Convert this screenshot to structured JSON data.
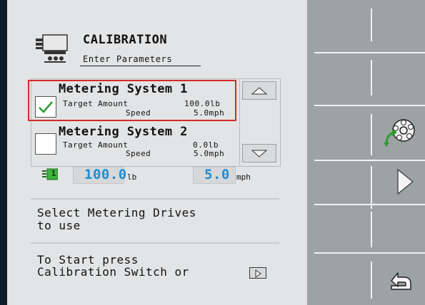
{
  "header": {
    "title": "CALIBRATION",
    "subtitle": "Enter Parameters",
    "icon": "metering-unit-icon"
  },
  "metering_list": {
    "items": [
      {
        "title": "Metering System 1",
        "checked": true,
        "target_label": "Target Amount",
        "target_value": "100.0lb",
        "speed_label": "Speed",
        "speed_value": "5.0mph"
      },
      {
        "title": "Metering System 2",
        "checked": false,
        "target_label": "Target Amount",
        "target_value": "0.0lb",
        "speed_label": "Speed",
        "speed_value": "5.0mph"
      }
    ],
    "scroll_up_icon": "triangle-up-icon",
    "scroll_down_icon": "triangle-down-icon"
  },
  "summary": {
    "meter_badge": "1",
    "amount": "100.0",
    "amount_unit": "lb",
    "speed": "5.0",
    "speed_unit": "mph"
  },
  "messages": {
    "select_line1": "Select Metering Drives",
    "select_line2": "to use",
    "start_line1": "To Start press",
    "start_line2": "Calibration Switch or"
  },
  "softkeys": [
    {
      "name": "softkey-1",
      "icon": ""
    },
    {
      "name": "softkey-2",
      "icon": ""
    },
    {
      "name": "softkey-3",
      "icon": "calibrate-meter-icon"
    },
    {
      "name": "softkey-4",
      "icon": "play-icon"
    },
    {
      "name": "softkey-5",
      "icon": ""
    },
    {
      "name": "softkey-6",
      "icon": "back-icon"
    }
  ],
  "colors": {
    "value_accent": "#1e8dd6",
    "selection_border": "#d42a2a",
    "check_green": "#2f9a2f",
    "softkey_panel": "#9da2a4",
    "content_panel": "#e3e4e5"
  }
}
